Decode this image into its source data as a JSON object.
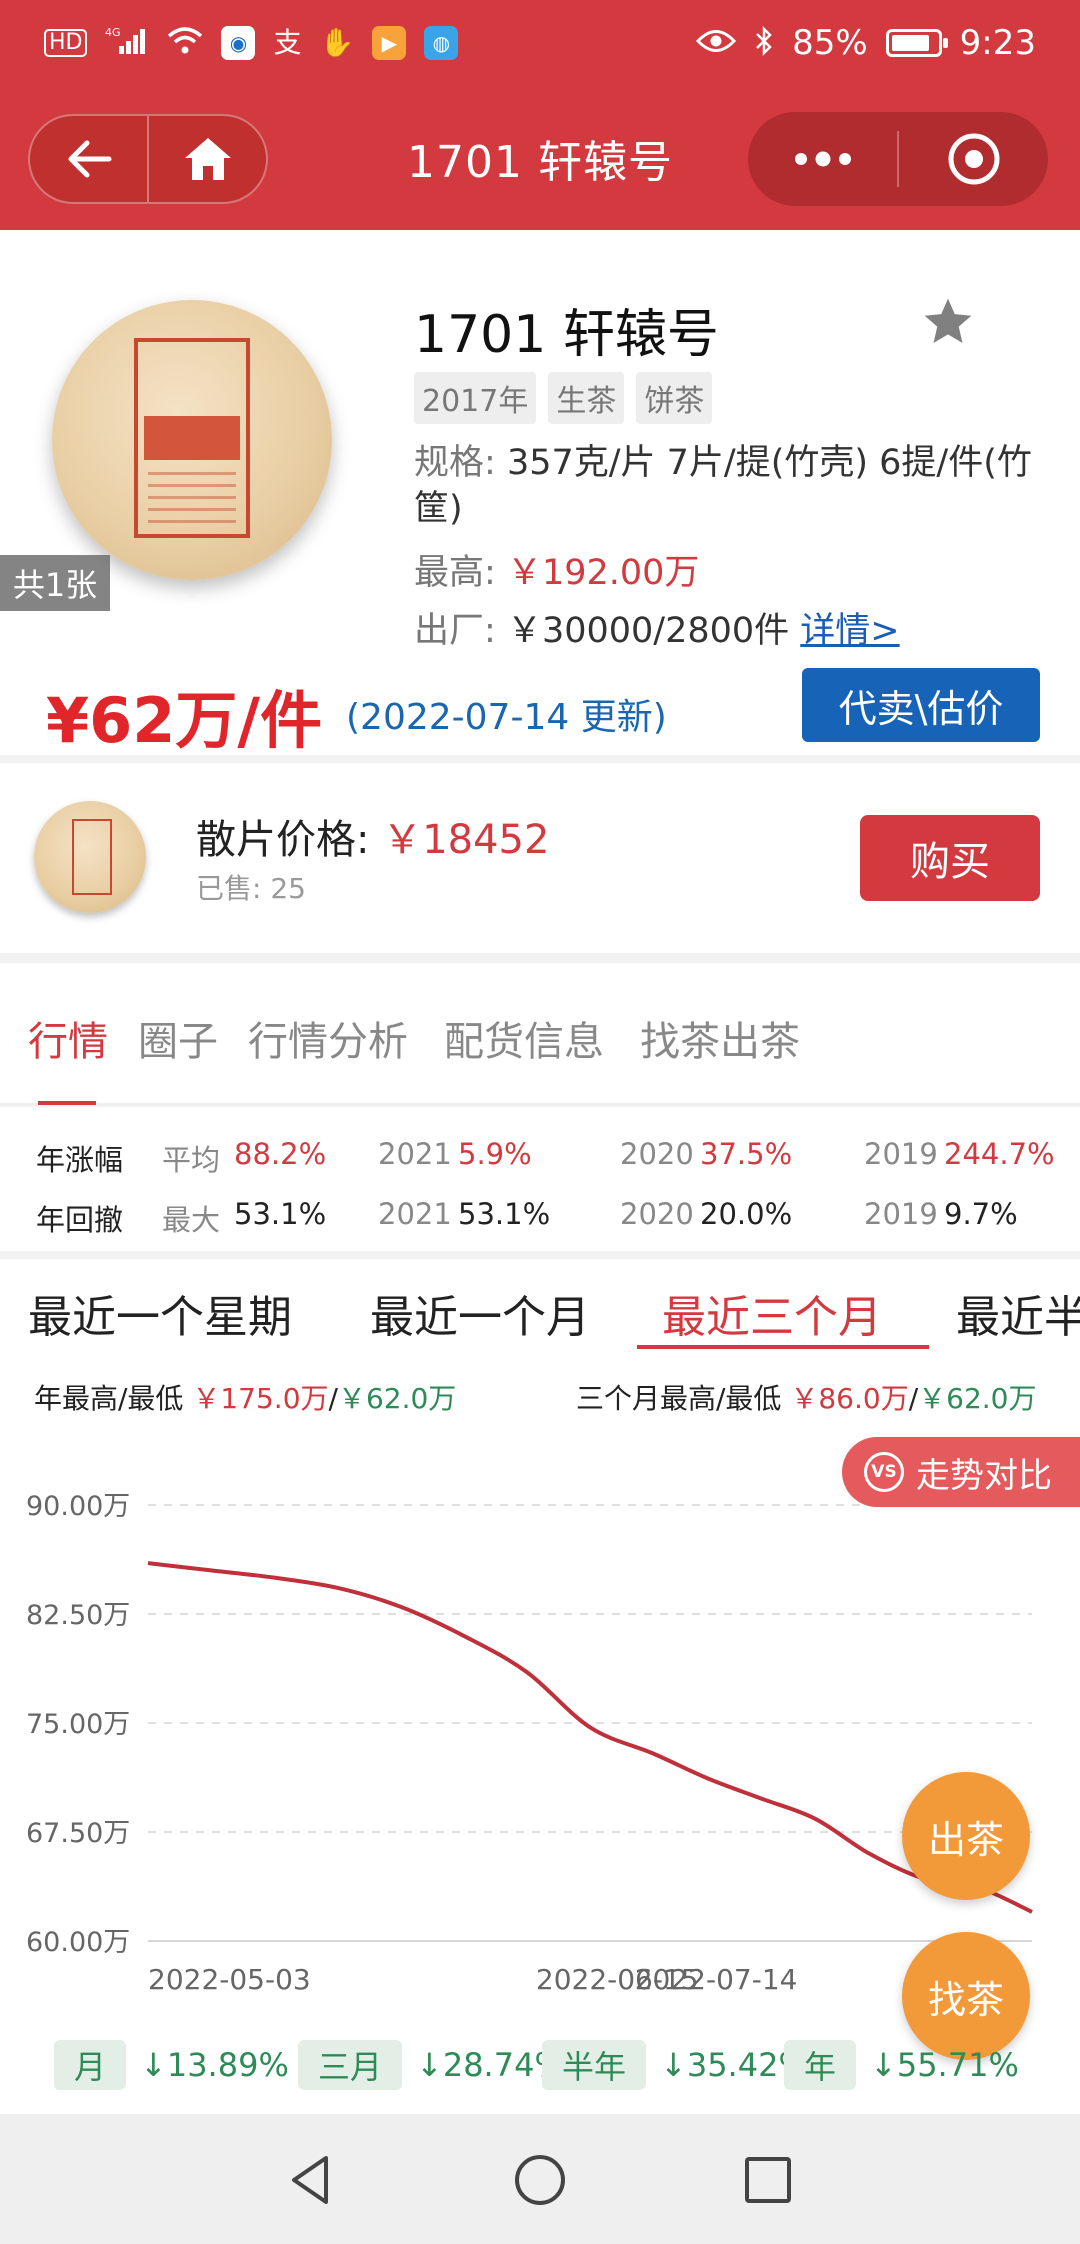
{
  "status_bar": {
    "net_label": "HD",
    "signal_label": "4G",
    "battery_percent": "85%",
    "time": "9:23",
    "battery_level": 0.85
  },
  "title_bar": {
    "title": "1701 轩辕号"
  },
  "product": {
    "name": "1701 轩辕号",
    "image_count": "共1张",
    "tags": [
      "2017年",
      "生茶",
      "饼茶"
    ],
    "spec_label": "规格:",
    "spec_value": "357克/片 7片/提(竹壳) 6提/件(竹筐)",
    "highest_label": "最高:",
    "highest_value": "￥192.00万",
    "factory_label": "出厂:",
    "factory_value": "￥30000/2800件",
    "details_link": "详情>",
    "price": "¥62万/件",
    "price_date": "(2022-07-14 更新)",
    "sell_button": "代卖\\估价"
  },
  "loose_piece": {
    "label": "散片价格:",
    "price": "￥18452",
    "sold": "已售: 25",
    "buy_button": "购买"
  },
  "tabs": [
    "行情",
    "圈子",
    "行情分析",
    "配货信息",
    "找茶出茶"
  ],
  "stats": {
    "growth": {
      "head": "年涨幅",
      "items": [
        {
          "k": "平均",
          "v": "88.2%"
        },
        {
          "k": "2021",
          "v": "5.9%"
        },
        {
          "k": "2020",
          "v": "37.5%"
        },
        {
          "k": "2019",
          "v": "244.7%"
        }
      ]
    },
    "drawdown": {
      "head": "年回撤",
      "items": [
        {
          "k": "最大",
          "v": "53.1%"
        },
        {
          "k": "2021",
          "v": "53.1%"
        },
        {
          "k": "2020",
          "v": "20.0%"
        },
        {
          "k": "2019",
          "v": "9.7%"
        }
      ]
    }
  },
  "range_tabs": [
    "最近一个星期",
    "最近一个月",
    "最近三个月",
    "最近半"
  ],
  "hilo": {
    "year_label": "年最高/最低",
    "year_high": "￥175.0万",
    "year_low": "￥62.0万",
    "three_month_label": "三个月最高/最低",
    "three_month_high": "￥86.0万",
    "three_month_low": "￥62.0万",
    "sep": "/"
  },
  "compare_button": "走势对比",
  "compare_icon": "VS",
  "fab_sell": "出茶",
  "fab_find": "找茶",
  "changes": [
    {
      "label": "月",
      "value": "↓13.89%"
    },
    {
      "label": "三月",
      "value": "↓28.74%"
    },
    {
      "label": "半年",
      "value": "↓35.42%"
    },
    {
      "label": "年",
      "value": "↓55.71%"
    }
  ],
  "chart_data": {
    "type": "line",
    "y_tick_labels": [
      "90.00万",
      "82.50万",
      "75.00万",
      "67.50万",
      "60.00万"
    ],
    "y_ticks": [
      90,
      82.5,
      75,
      67.5,
      60
    ],
    "ylim": [
      60,
      90
    ],
    "x_tick_labels": [
      "2022-05-03",
      "2022-06-15",
      "2022-07-14"
    ],
    "grid": true,
    "line_color": "#c0303a",
    "points": [
      {
        "x": "2022-05-03",
        "y": 86.0
      },
      {
        "x": "2022-05-10",
        "y": 85.5
      },
      {
        "x": "2022-05-17",
        "y": 85.0
      },
      {
        "x": "2022-05-24",
        "y": 84.3
      },
      {
        "x": "2022-05-31",
        "y": 83.0
      },
      {
        "x": "2022-06-07",
        "y": 81.0
      },
      {
        "x": "2022-06-14",
        "y": 78.5
      },
      {
        "x": "2022-06-21",
        "y": 74.7
      },
      {
        "x": "2022-06-28",
        "y": 72.9
      },
      {
        "x": "2022-07-04",
        "y": 71.2
      },
      {
        "x": "2022-07-10",
        "y": 69.8
      },
      {
        "x": "2022-07-16",
        "y": 68.4
      },
      {
        "x": "2022-07-22",
        "y": 66.0
      },
      {
        "x": "2022-07-28",
        "y": 64.3
      },
      {
        "x": "2022-08-03",
        "y": 63.7
      },
      {
        "x": "2022-08-09",
        "y": 62.0
      }
    ]
  },
  "colors": {
    "brand_red": "#d23a3f",
    "blue_button": "#1763b8",
    "green": "#2e8b57",
    "orange_fab": "#f29a3a"
  }
}
